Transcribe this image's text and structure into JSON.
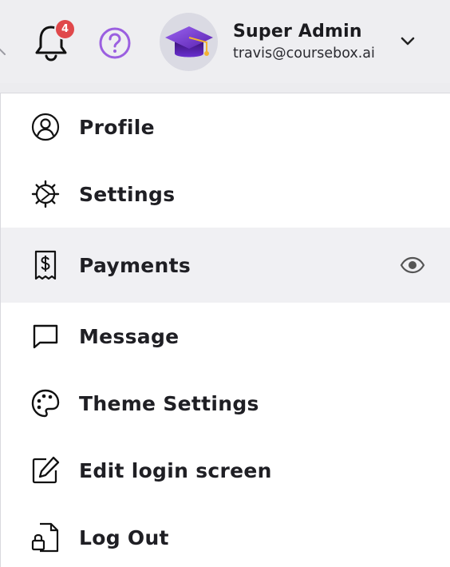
{
  "header": {
    "notifications": {
      "count": "4",
      "icon": "bell-icon"
    },
    "help": {
      "icon": "help-icon"
    },
    "user": {
      "name": "Super Admin",
      "email": "travis@coursebox.ai",
      "avatar_icon": "graduation-cap-icon",
      "menu_icon": "chevron-down-icon"
    }
  },
  "menu": {
    "items": [
      {
        "label": "Profile",
        "icon": "user-circle-icon"
      },
      {
        "label": "Settings",
        "icon": "gear-icon"
      },
      {
        "label": "Payments",
        "icon": "receipt-dollar-icon",
        "active": true,
        "trailing_icon": "eye-icon"
      },
      {
        "label": "Message",
        "icon": "message-square-icon"
      },
      {
        "label": "Theme Settings",
        "icon": "palette-icon"
      },
      {
        "label": "Edit login screen",
        "icon": "edit-icon"
      },
      {
        "label": "Log Out",
        "icon": "logout-file-lock-icon"
      }
    ]
  },
  "colors": {
    "badge": "#e0484b",
    "help_accent": "#9b5fe0",
    "avatar_purple": "#6d2fc7",
    "active_row": "#f0f0f3"
  }
}
